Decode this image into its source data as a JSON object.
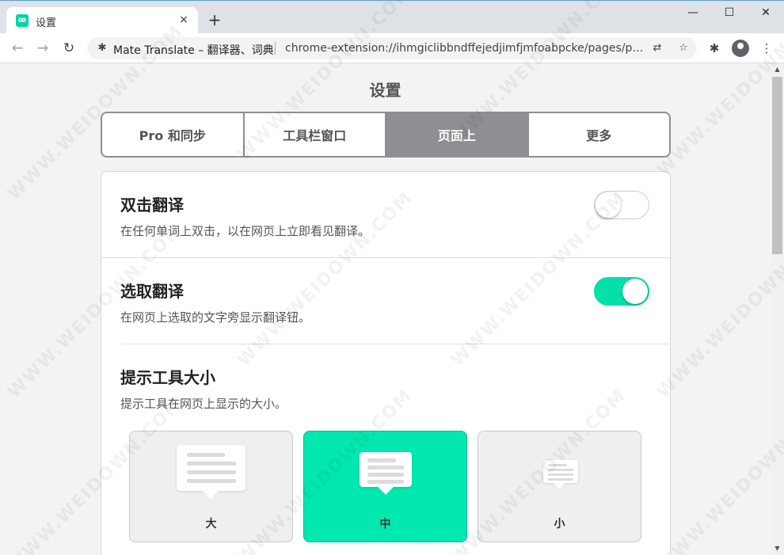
{
  "browser": {
    "tab": {
      "title": "设置",
      "favicon_text": "æ",
      "close_icon": "×"
    },
    "new_tab_icon": "+",
    "window_controls": {
      "minimize": "—",
      "maximize": "☐",
      "close": "✕"
    },
    "nav": {
      "back": "←",
      "forward": "→",
      "reload": "↻"
    },
    "omnibox": {
      "site_name": "Mate Translate – 翻译器、词典",
      "url": "chrome-extension://ihmgiclibbndffejedjimfjmfoabpcke/pages/pu...",
      "translate_icon": "⇄",
      "bookmark_icon": "☆"
    },
    "toolbar_icons": {
      "extensions": "✱",
      "menu": "⋮"
    }
  },
  "page": {
    "title": "设置",
    "tabs": [
      {
        "label": "Pro 和同步"
      },
      {
        "label": "工具栏窗口"
      },
      {
        "label": "页面上"
      },
      {
        "label": "更多"
      }
    ],
    "active_tab": 2,
    "settings": {
      "double_click": {
        "title": "双击翻译",
        "desc": "在任何单词上双击，以在网页上立即看见翻译。",
        "enabled": false
      },
      "selection": {
        "title": "选取翻译",
        "desc": "在网页上选取的文字旁显示翻译钮。",
        "enabled": true
      },
      "tooltip_size": {
        "title": "提示工具大小",
        "desc": "提示工具在网页上显示的大小。",
        "options": [
          {
            "label": "大"
          },
          {
            "label": "中"
          },
          {
            "label": "小"
          }
        ],
        "selected": 1
      }
    }
  },
  "colors": {
    "accent": "#00e0a8",
    "segment_active": "#8e8e93",
    "tab_strip": "#dee1e6"
  },
  "watermark": "WWW.WEIDOWN.COM"
}
